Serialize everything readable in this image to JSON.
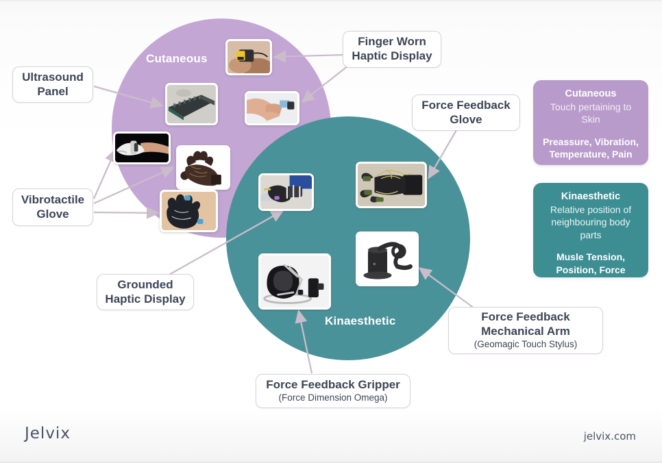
{
  "diagram": {
    "circles": [
      {
        "id": "cutaneous",
        "label": "Cutaneous",
        "color": "#c3a6d3"
      },
      {
        "id": "kinaesthetic",
        "label": "Kinaesthetic",
        "color": "#4a9299"
      }
    ],
    "callouts": [
      {
        "id": "ultrasound",
        "main": "Ultrasound\nPanel",
        "sub": ""
      },
      {
        "id": "vibrotactile",
        "main": "Vibrotactile\nGlove",
        "sub": ""
      },
      {
        "id": "grounded",
        "main": "Grounded\nHaptic Display",
        "sub": ""
      },
      {
        "id": "finger",
        "main": "Finger Worn\nHaptic Display",
        "sub": ""
      },
      {
        "id": "forceglove",
        "main": "Force Feedback\nGlove",
        "sub": ""
      },
      {
        "id": "mecharm",
        "main": "Force Feedback\nMechanical Arm",
        "sub": "(Geomagic Touch Stylus)"
      },
      {
        "id": "gripper",
        "main": "Force Feedback Gripper",
        "sub": "(Force Dimension Omega)"
      }
    ],
    "cards": [
      {
        "id": "cutaneous",
        "title": "Cutaneous",
        "desc": "Touch pertaining to Skin",
        "keys": "Preassure, Vibration, Temperature, Pain",
        "color": "#b99bcb"
      },
      {
        "id": "kinaesthetic",
        "title": "Kinaesthetic",
        "desc": "Relative position of neighbouring body parts",
        "keys": "Musle Tension, Position, Force",
        "color": "#3d8e93"
      }
    ],
    "thumbnails": [
      {
        "id": "finger-worn-ring",
        "alt": "finger worn haptic ring on hand"
      },
      {
        "id": "ultrasound-panel",
        "alt": "ultrasound transducer array panel"
      },
      {
        "id": "finger-clip-device",
        "alt": "hand with finger clip haptic device"
      },
      {
        "id": "white-hand-device",
        "alt": "white hand mounted device on black background"
      },
      {
        "id": "wired-black-glove",
        "alt": "black glove with wiring"
      },
      {
        "id": "vibrotactile-glove",
        "alt": "black vibrotactile glove pair"
      },
      {
        "id": "grounded-haptic-rig",
        "alt": "grounded haptic arm rig with user hand"
      },
      {
        "id": "force-feedback-glove",
        "alt": "exoskeleton force feedback glove"
      },
      {
        "id": "geomagic-touch-stylus",
        "alt": "geomagic touch stylus arm"
      },
      {
        "id": "omega-gripper",
        "alt": "force dimension omega gripper"
      }
    ],
    "connector_color": "#c9bcc9"
  },
  "footer": {
    "brand": "Jelvix",
    "site": "jelvix.com"
  }
}
